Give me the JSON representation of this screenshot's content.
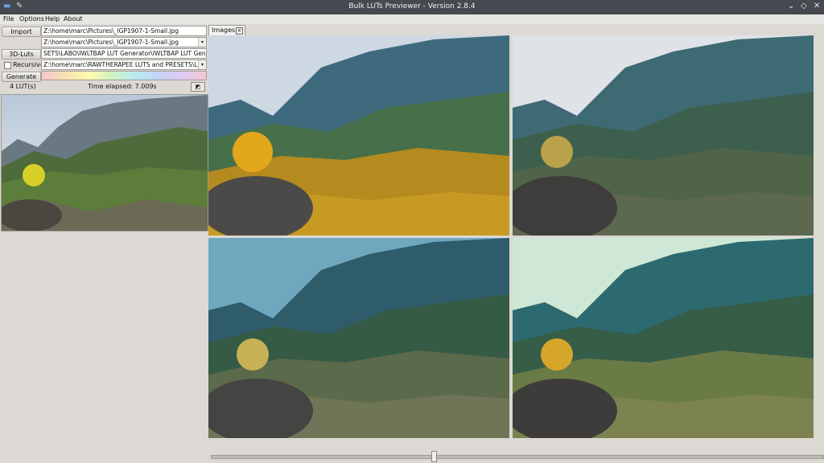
{
  "window": {
    "title": "Bulk LUTs Previewer - Version 2.8.4",
    "controls": [
      "chevron-down-icon",
      "diamond-icon",
      "close-icon"
    ]
  },
  "menu": [
    "File",
    "Options",
    "Help",
    "About"
  ],
  "controls": {
    "import_label": "Import",
    "import_path": "Z:\\home\\marc\\Pictures\\_IGP1907-1-Small.jpg",
    "image_combo": "Z:\\home\\marc\\Pictures\\_IGP1907-1-Small.jpg",
    "luts_label": "3D-Luts",
    "luts_path": "SETS\\LABO\\IWLTBAP LUT Generator\\IWLTBAP LUT Generator",
    "recursive_label": "Recursive",
    "recursive_checked": false,
    "recursive_path": "Z:\\home\\marc\\RAWTHERAPEE LUTS and PRESETS\\LABO\\IW",
    "generate_label": "Generate",
    "lut_count": "4 LUT(s)",
    "time_elapsed": "Time elapsed: 7.009s"
  },
  "tabs": [
    {
      "label": "Images",
      "closable": true
    }
  ],
  "slider": {
    "value": 0.36
  },
  "colors": {
    "titlebar": "#454a50",
    "window_bg": "#dcd9d4"
  }
}
